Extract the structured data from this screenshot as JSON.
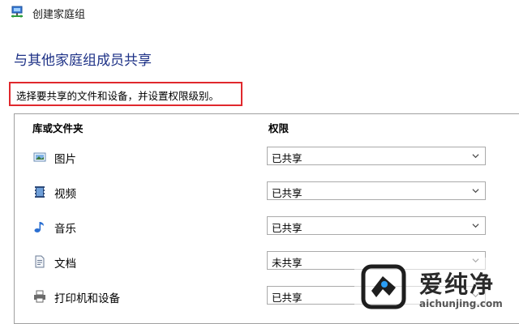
{
  "window": {
    "title": "创建家庭组",
    "title_icon": "homegroup-network-icon"
  },
  "heading": "与其他家庭组成员共享",
  "instruction": "选择要共享的文件和设备，并设置权限级别。",
  "colors": {
    "heading": "#1e3287",
    "highlight_border": "#e0282d"
  },
  "table": {
    "col_library": "库或文件夹",
    "col_permission": "权限",
    "rows": [
      {
        "label": "图片",
        "icon": "pictures-icon",
        "permission": "已共享"
      },
      {
        "label": "视频",
        "icon": "videos-icon",
        "permission": "已共享"
      },
      {
        "label": "音乐",
        "icon": "music-icon",
        "permission": "已共享"
      },
      {
        "label": "文档",
        "icon": "documents-icon",
        "permission": "未共享"
      },
      {
        "label": "打印机和设备",
        "icon": "printer-icon",
        "permission": "已共享"
      }
    ]
  },
  "watermark": {
    "brand": "爱纯净",
    "url": "aichunjing.com"
  }
}
